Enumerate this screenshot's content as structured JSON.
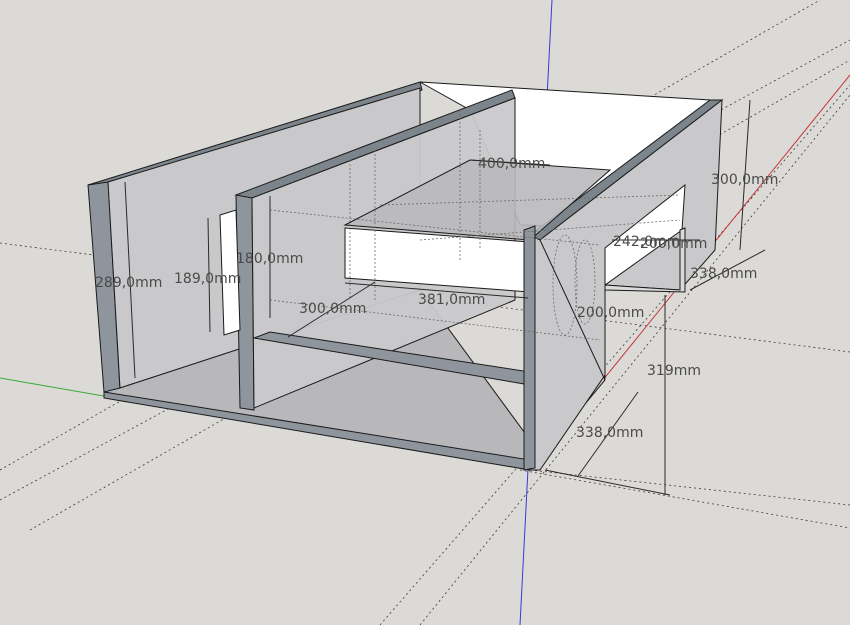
{
  "app": "SketchUp",
  "colors": {
    "background": "#dcdad6",
    "panel_face": "#c9c9cb",
    "panel_edge": "#8e959c",
    "panel_top": "#7c848c",
    "open_face": "#ffffff",
    "axis_red": "#d23a3a",
    "axis_green": "#3aa83a",
    "axis_blue": "#3a3ad8"
  },
  "dimensions": {
    "d_289": "289,0mm",
    "d_189": "189,0mm",
    "d_180": "180,0mm",
    "d_300a": "300,0mm",
    "d_381": "381,0mm",
    "d_200a": "200,0mm",
    "d_300b": "300,0mm",
    "d_338a": "338,0mm",
    "d_200b": "200,0mm",
    "d_242": "242,0mm",
    "d_319": "319mm",
    "d_338b": "338,0mm",
    "d_top_overlap": "400,0mm"
  }
}
